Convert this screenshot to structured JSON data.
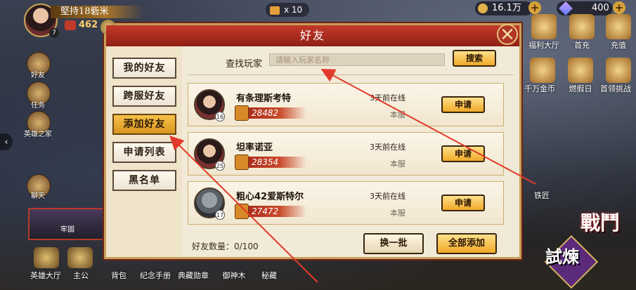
{
  "hud": {
    "player_name": "堅持18砦米",
    "level": "7",
    "power": "462",
    "tickets": "x 10",
    "coins": "16.1万",
    "gems": "400"
  },
  "left_menu": {
    "friends": "好友",
    "tasks": "任务",
    "hero_home": "英雄之家",
    "chat": "聊天",
    "fortress": "牢固"
  },
  "right_menu": {
    "welfare": "福利大厅",
    "first_charge": "首充",
    "recharge": "充值",
    "gold_coin": "千万金币",
    "holiday": "燃假日",
    "first_challenge": "首领挑战",
    "blacksmith": "铁匠",
    "battle": "戰鬥",
    "trial": "試煉"
  },
  "bottom_menu": [
    "英雄大厅",
    "主公",
    "背包",
    "纪念手册",
    "典藏勋章",
    "御神木",
    "秘藏"
  ],
  "dialog": {
    "title": "好友",
    "tabs": [
      "我的好友",
      "跨服好友",
      "添加好友",
      "申请列表",
      "黑名单"
    ],
    "active_tab": "添加好友",
    "search_label": "查找玩家",
    "search_placeholder": "请输入玩家名称",
    "search_button": "搜索",
    "friends": [
      {
        "name": "有条理斯考特",
        "level": "16",
        "power": "28482",
        "status": "3天前在线",
        "server": "本服",
        "action": "申请"
      },
      {
        "name": "坦率诺亚",
        "level": "25",
        "power": "28354",
        "status": "3天前在线",
        "server": "本服",
        "action": "申请"
      },
      {
        "name": "粗心42爱斯特尔",
        "level": "17",
        "power": "27472",
        "status": "3天前在线",
        "server": "本服",
        "action": "申请"
      }
    ],
    "friend_count": "好友数量：0/100",
    "refresh_button": "换一批",
    "add_all_button": "全部添加"
  },
  "colors": {
    "accent_red": "#b03526",
    "gold_button": "#f0a928",
    "annotation_arrow": "#e23a2a"
  }
}
